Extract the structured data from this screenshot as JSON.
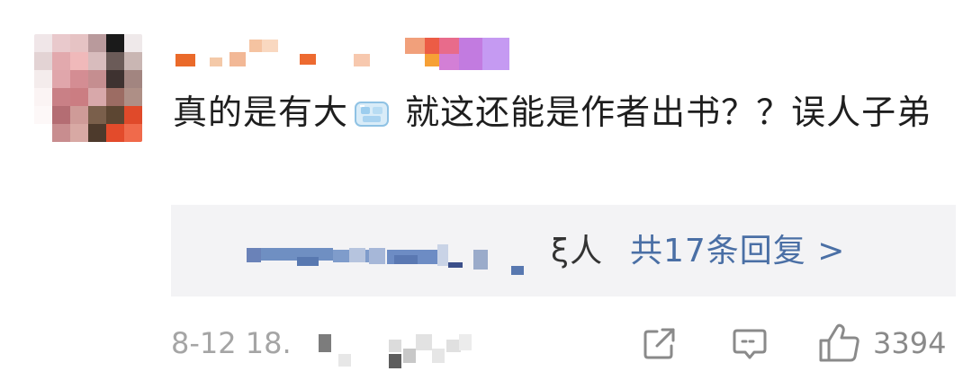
{
  "comment": {
    "text_before_emoji": "真的是有大",
    "emoji_icon": "ice-cube-icon",
    "text_after_emoji": " 就这还能是作者出书？？误人子弟"
  },
  "replies": {
    "preview_tail": "ξ人",
    "count_label": "共17条回复 >"
  },
  "footer": {
    "timestamp": "8-12 18.",
    "like_count": "3394",
    "icons": {
      "share": "share-icon",
      "comment": "comment-icon",
      "like": "thumbs-up-icon"
    }
  },
  "colors": {
    "link_blue": "#4a6fa5",
    "meta_gray": "#a5a5a5",
    "reply_box_bg": "#f3f3f5"
  }
}
